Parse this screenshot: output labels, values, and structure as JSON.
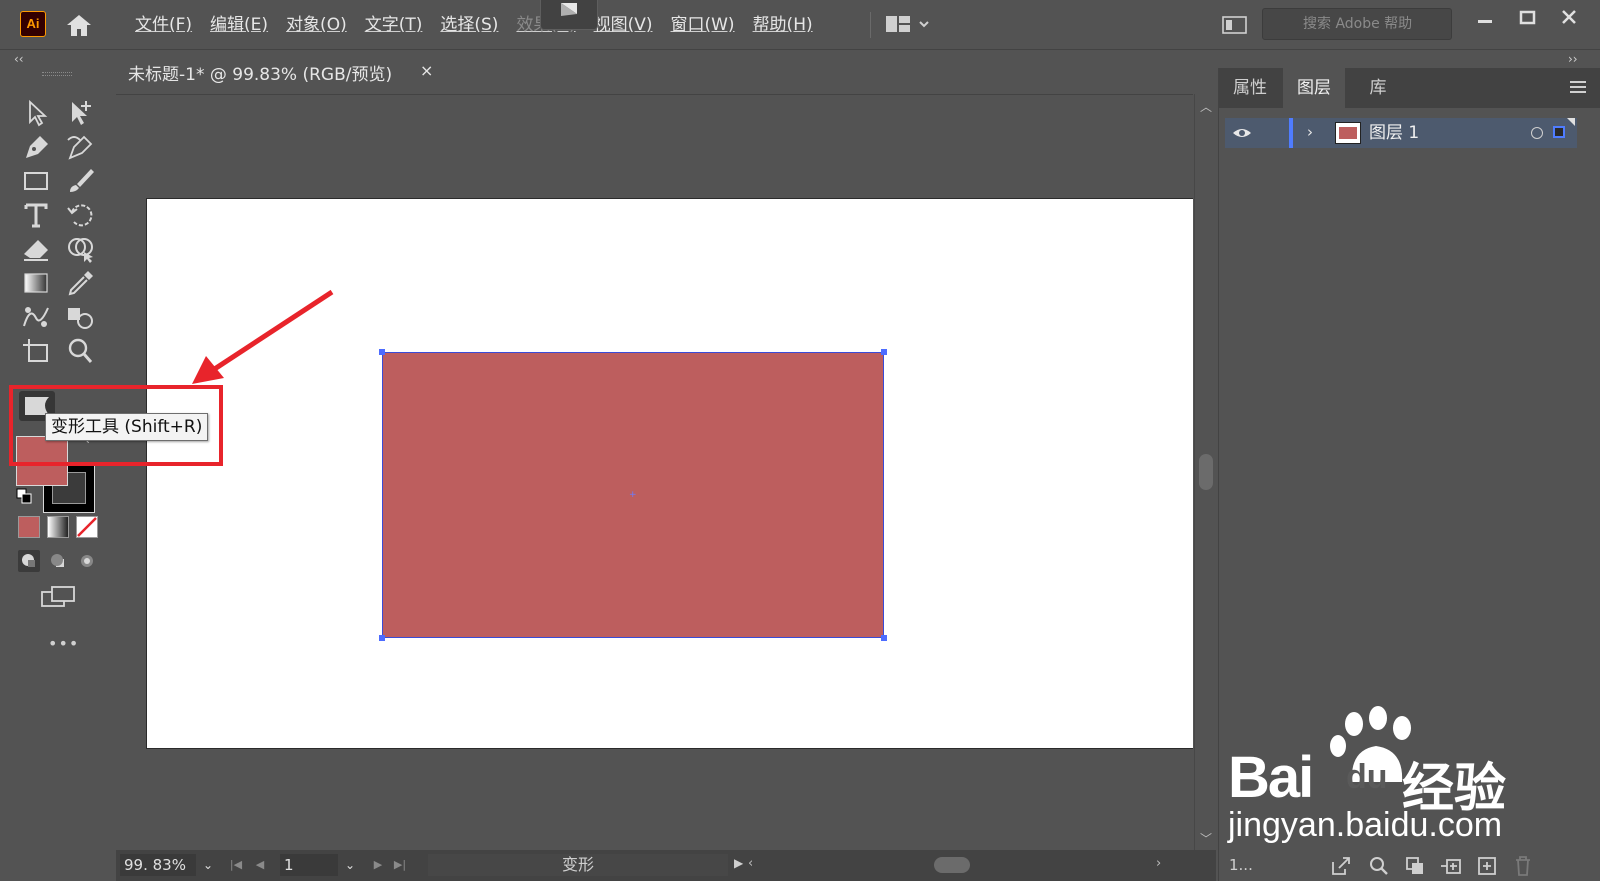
{
  "app": {
    "logo_text": "Ai"
  },
  "menu": {
    "items": [
      "文件(F)",
      "编辑(E)",
      "对象(O)",
      "文字(T)",
      "选择(S)",
      "效果(C)",
      "视图(V)",
      "窗口(W)",
      "帮助(H)"
    ]
  },
  "search": {
    "placeholder": "搜索 Adobe 帮助"
  },
  "document": {
    "tab_title": "未标题-1* @ 99.83% (RGB/预览)",
    "close_glyph": "×"
  },
  "tooltip": {
    "text": "变形工具 (Shift+R)"
  },
  "colors": {
    "fill": "#bd5e5e",
    "stroke": "#000000",
    "selection": "#4d6cff",
    "highlight_annotation": "#e8242b"
  },
  "status": {
    "zoom": "99. 83%",
    "page": "1",
    "current_tool": "变形"
  },
  "panel": {
    "tabs": [
      "属性",
      "图层",
      "库"
    ],
    "active_tab": "图层",
    "layer_name": "图层 1",
    "layer_count": "1..."
  },
  "toolbar": {
    "more_label": "•••"
  },
  "watermark": {
    "brand": "Bai",
    "brand_suffix": "du",
    "product": "经验",
    "url": "jingyan.baidu.com"
  },
  "icons": [
    "home-icon",
    "workspace-icon",
    "search-icon",
    "eye-icon",
    "chevron-right-icon",
    "panel-menu-icon"
  ]
}
